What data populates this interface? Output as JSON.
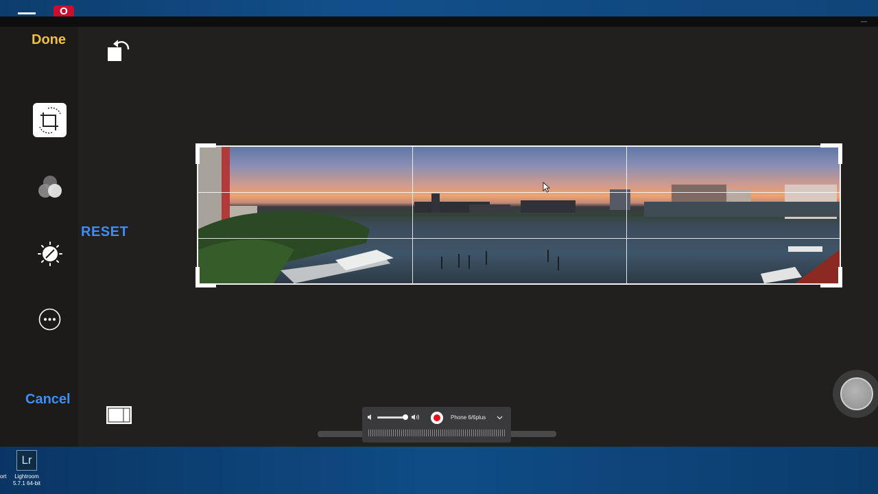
{
  "toolbar": {
    "done_label": "Done",
    "cancel_label": "Cancel",
    "reset_label": "RESET"
  },
  "tools": [
    {
      "icon": "crop-rotate-icon",
      "selected": true
    },
    {
      "icon": "filters-icon"
    },
    {
      "icon": "adjust-icon"
    },
    {
      "icon": "more-icon"
    }
  ],
  "recorder": {
    "device": "Phone 6/6plus"
  },
  "taskbar": {
    "app_icon_text": "Lr",
    "app_name": "Lightroom",
    "app_version": "5.7.1 64-bit",
    "cut_label": "ort"
  },
  "colors": {
    "done": "#f2c135",
    "action_blue": "#3b8ff5",
    "record_red": "#e2111a"
  }
}
